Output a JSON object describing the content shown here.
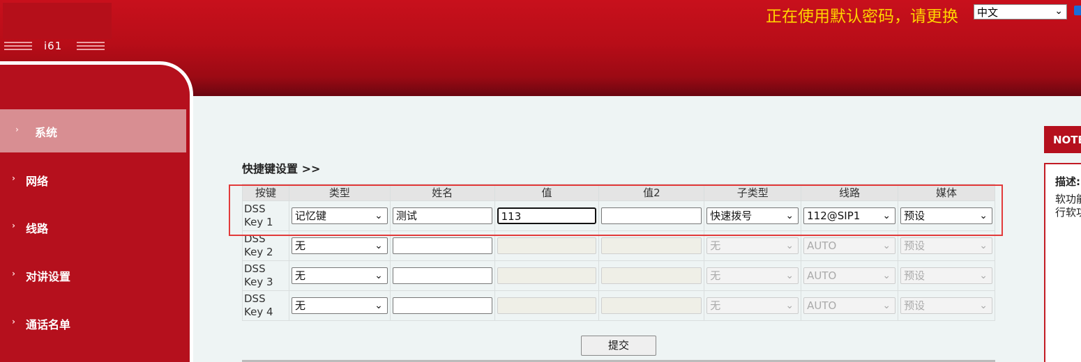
{
  "header": {
    "model": "i61",
    "warning": "正在使用默认密码，请更换",
    "language": "中文"
  },
  "nav": {
    "items": [
      {
        "label": "系统",
        "active": true
      },
      {
        "label": "网络"
      },
      {
        "label": "线路"
      },
      {
        "label": "对讲设置"
      },
      {
        "label": "通话名单"
      }
    ]
  },
  "main": {
    "title": "快捷键设置 >>",
    "columns": [
      "按键",
      "类型",
      "姓名",
      "值",
      "值2",
      "子类型",
      "线路",
      "媒体"
    ],
    "rows": [
      {
        "key": "DSS Key 1",
        "type": "记忆键",
        "name": "测试",
        "value": "113",
        "value2": "",
        "subtype": "快速拨号",
        "line": "112@SIP1",
        "media": "预设"
      },
      {
        "key": "DSS Key 2",
        "type": "无",
        "name": "",
        "value": "",
        "value2": "",
        "subtype": "无",
        "line": "AUTO",
        "media": "预设"
      },
      {
        "key": "DSS Key 3",
        "type": "无",
        "name": "",
        "value": "",
        "value2": "",
        "subtype": "无",
        "line": "AUTO",
        "media": "预设"
      },
      {
        "key": "DSS Key 4",
        "type": "无",
        "name": "",
        "value": "",
        "value2": "",
        "subtype": "无",
        "line": "AUTO",
        "media": "预设"
      }
    ],
    "submit_label": "提交"
  },
  "note": {
    "tab": "NOTE",
    "title": "描述:",
    "lines": [
      "软功能",
      "行软功"
    ]
  }
}
